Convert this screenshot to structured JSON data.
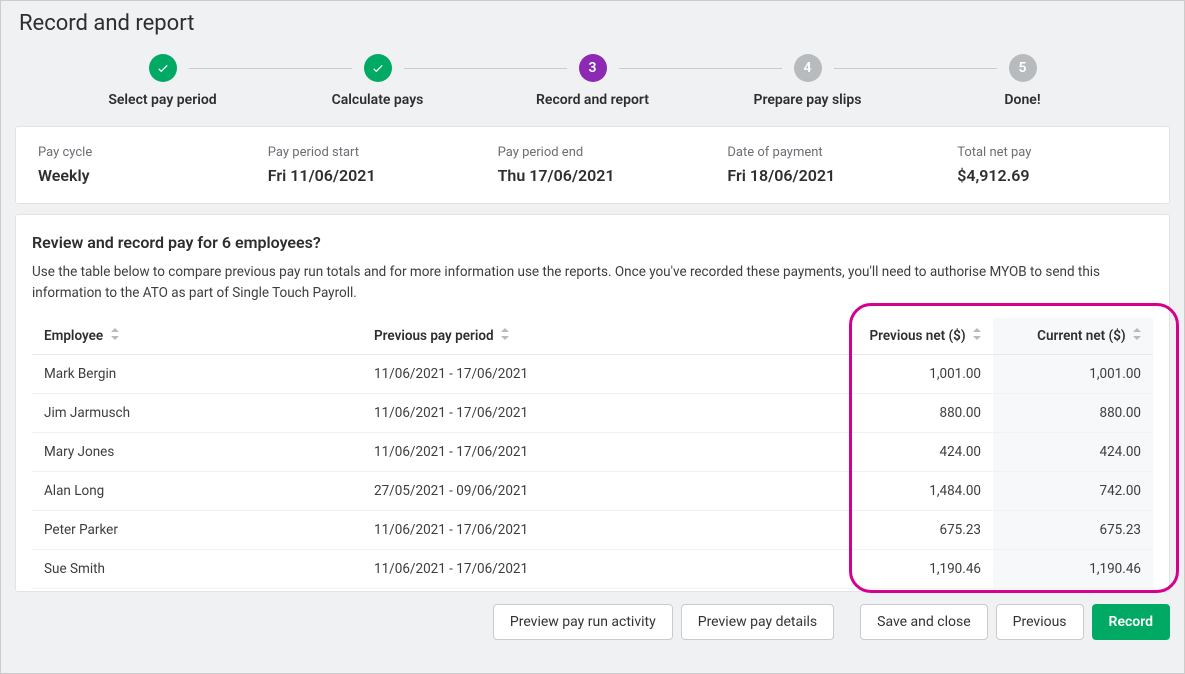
{
  "page_title": "Record and report",
  "steps": [
    {
      "label": "Select pay period",
      "status": "done"
    },
    {
      "label": "Calculate pays",
      "status": "done"
    },
    {
      "label": "Record and report",
      "status": "current",
      "number": "3"
    },
    {
      "label": "Prepare pay slips",
      "status": "future",
      "number": "4"
    },
    {
      "label": "Done!",
      "status": "future",
      "number": "5"
    }
  ],
  "summary": {
    "pay_cycle_label": "Pay cycle",
    "pay_cycle_value": "Weekly",
    "period_start_label": "Pay period start",
    "period_start_value": "Fri 11/06/2021",
    "period_end_label": "Pay period end",
    "period_end_value": "Thu 17/06/2021",
    "payment_date_label": "Date of payment",
    "payment_date_value": "Fri 18/06/2021",
    "total_net_label": "Total net pay",
    "total_net_value": "$4,912.69"
  },
  "review": {
    "title": "Review and record pay for 6 employees?",
    "description": "Use the table below to compare previous pay run totals and for more information use the reports. Once you've recorded these payments, you'll need to authorise MYOB to send this information to the ATO as part of Single Touch Payroll."
  },
  "table": {
    "headers": {
      "employee": "Employee",
      "prev_period": "Previous pay period",
      "prev_net": "Previous net ($)",
      "curr_net": "Current net ($)"
    },
    "rows": [
      {
        "employee": "Mark Bergin",
        "prev_period": "11/06/2021 - 17/06/2021",
        "prev_net": "1,001.00",
        "curr_net": "1,001.00"
      },
      {
        "employee": "Jim Jarmusch",
        "prev_period": "11/06/2021 - 17/06/2021",
        "prev_net": "880.00",
        "curr_net": "880.00"
      },
      {
        "employee": "Mary Jones",
        "prev_period": "11/06/2021 - 17/06/2021",
        "prev_net": "424.00",
        "curr_net": "424.00"
      },
      {
        "employee": "Alan Long",
        "prev_period": "27/05/2021 - 09/06/2021",
        "prev_net": "1,484.00",
        "curr_net": "742.00"
      },
      {
        "employee": "Peter Parker",
        "prev_period": "11/06/2021 - 17/06/2021",
        "prev_net": "675.23",
        "curr_net": "675.23"
      },
      {
        "employee": "Sue Smith",
        "prev_period": "11/06/2021 - 17/06/2021",
        "prev_net": "1,190.46",
        "curr_net": "1,190.46"
      }
    ]
  },
  "buttons": {
    "preview_activity": "Preview pay run activity",
    "preview_details": "Preview pay details",
    "save_close": "Save and close",
    "previous": "Previous",
    "record": "Record"
  }
}
